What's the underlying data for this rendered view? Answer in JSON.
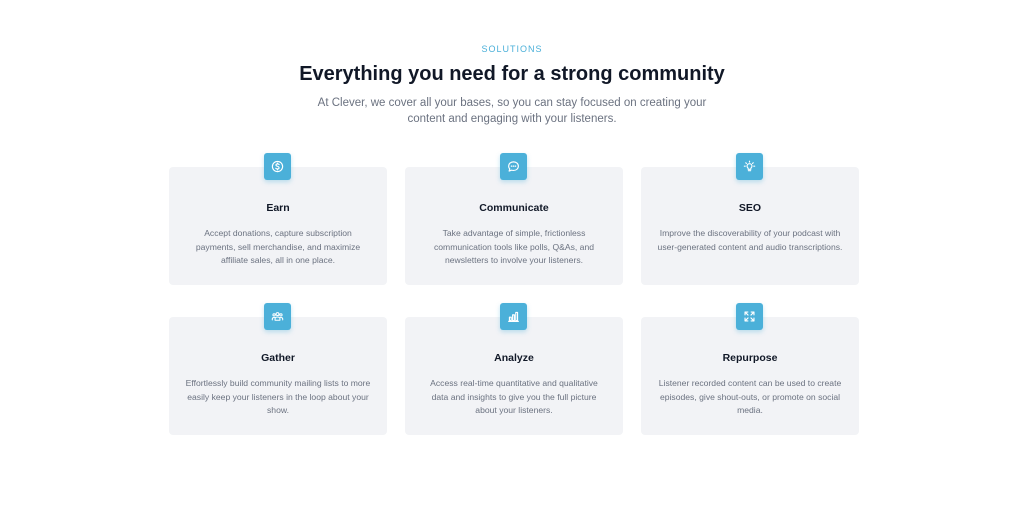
{
  "section": {
    "eyebrow": "SOLUTIONS",
    "headline": "Everything you need for a strong community",
    "subtitle": "At Clever, we cover all your bases, so you can stay focused on creating your content and engaging with your listeners."
  },
  "features": [
    {
      "title": "Earn",
      "icon": "dollar-coin-icon",
      "text": "Accept donations, capture subscription payments, sell merchandise, and maximize affiliate sales, all in one place."
    },
    {
      "title": "Communicate",
      "icon": "chat-bubble-icon",
      "text": "Take advantage of simple, frictionless communication tools like polls, Q&As, and newsletters to involve your listeners."
    },
    {
      "title": "SEO",
      "icon": "lightbulb-icon",
      "text": "Improve the discoverability of your podcast with user-generated content and audio transcriptions."
    },
    {
      "title": "Gather",
      "icon": "user-group-icon",
      "text": "Effortlessly build community mailing lists to more easily keep your listeners in the loop about your show."
    },
    {
      "title": "Analyze",
      "icon": "bar-chart-icon",
      "text": "Access real-time quantitative and qualitative data and insights to give you the full picture about your listeners."
    },
    {
      "title": "Repurpose",
      "icon": "expand-arrows-icon",
      "text": "Listener recorded content can be used to create episodes, give shout-outs, or promote on social media."
    }
  ],
  "colors": {
    "accent": "#4bb0d9",
    "card_background": "#f2f3f6",
    "heading": "#111827",
    "body_text": "#6b7280"
  }
}
